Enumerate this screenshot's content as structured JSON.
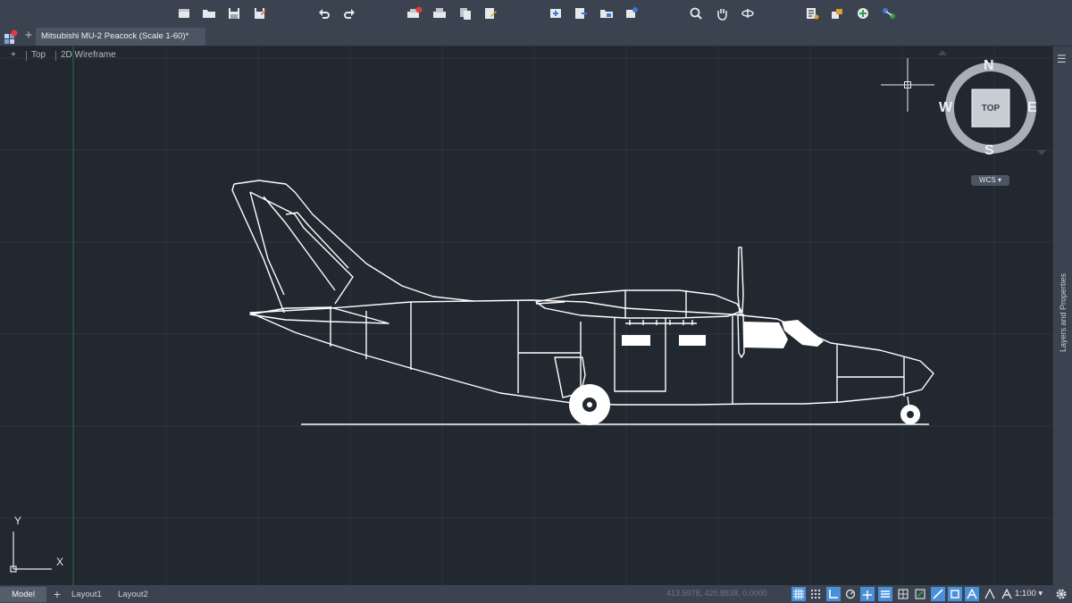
{
  "document": {
    "tab_title": "Mitsubishi MU-2 Peacock (Scale 1-60)*",
    "new_tab_glyph": "+"
  },
  "viewport": {
    "control": "+",
    "view": "Top",
    "visual_style": "2D Wireframe"
  },
  "viewcube": {
    "face": "TOP",
    "north": "N",
    "south": "S",
    "east": "E",
    "west": "W",
    "ucs": "WCS"
  },
  "ucs_icon": {
    "x_label": "X",
    "y_label": "Y"
  },
  "side_panel": {
    "label": "Layers and Properties"
  },
  "status_bar": {
    "model_tab": "Model",
    "add_layout": "+",
    "layouts": [
      "Layout1",
      "Layout2"
    ],
    "coordinates": "413.5978, 420.8838, 0.0000",
    "annotation_scale": "1:100"
  },
  "toolbar": {
    "icons": [
      "new-icon",
      "open-icon",
      "save-icon",
      "save-as-icon",
      "undo-icon",
      "redo-icon",
      "plot-icon",
      "print-icon",
      "publish-icon",
      "edit-icon",
      "import-icon",
      "export-icon",
      "folder-icon",
      "share-icon",
      "zoom-icon",
      "pan-icon",
      "orbit-icon",
      "properties-icon",
      "layer-icon",
      "add-icon",
      "connect-icon"
    ]
  },
  "colors": {
    "background": "#212830",
    "chrome": "#3b4350",
    "drawing": "#ffffff",
    "grid_major": "#2f3945",
    "accent": "#4a90d9"
  }
}
